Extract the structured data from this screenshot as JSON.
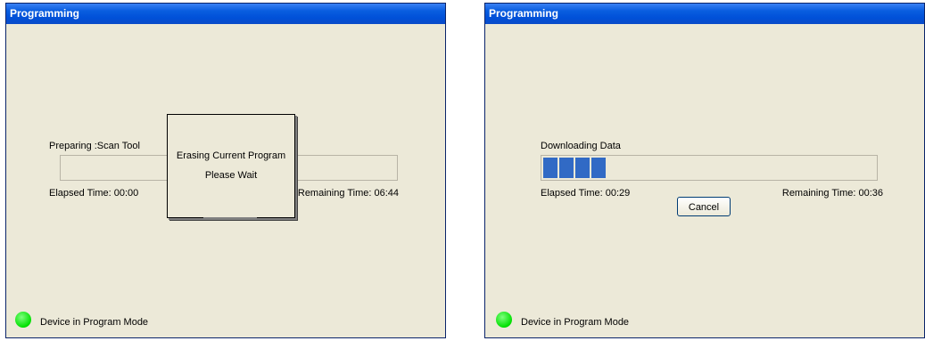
{
  "left_window": {
    "title": "Programming",
    "status_label": "Preparing :Scan Tool",
    "progress": 0,
    "elapsed_label": "Elapsed Time: 00:00",
    "remaining_label": "Remaining Time: 06:44",
    "dialog": {
      "line1": "Erasing Current Program",
      "line2": "Please Wait"
    },
    "mode_label": "Device in Program Mode",
    "mode_color": "#00e000"
  },
  "right_window": {
    "title": "Programming",
    "status_label": "Downloading Data",
    "progress_blocks": 4,
    "elapsed_label": "Elapsed Time: 00:29",
    "remaining_label": "Remaining Time: 00:36",
    "cancel_label": "Cancel",
    "mode_label": "Device in Program Mode",
    "mode_color": "#00e000"
  },
  "colors": {
    "titlebar": "#0054e3",
    "window_bg": "#ece9d8",
    "progress_block": "#316ac5"
  }
}
